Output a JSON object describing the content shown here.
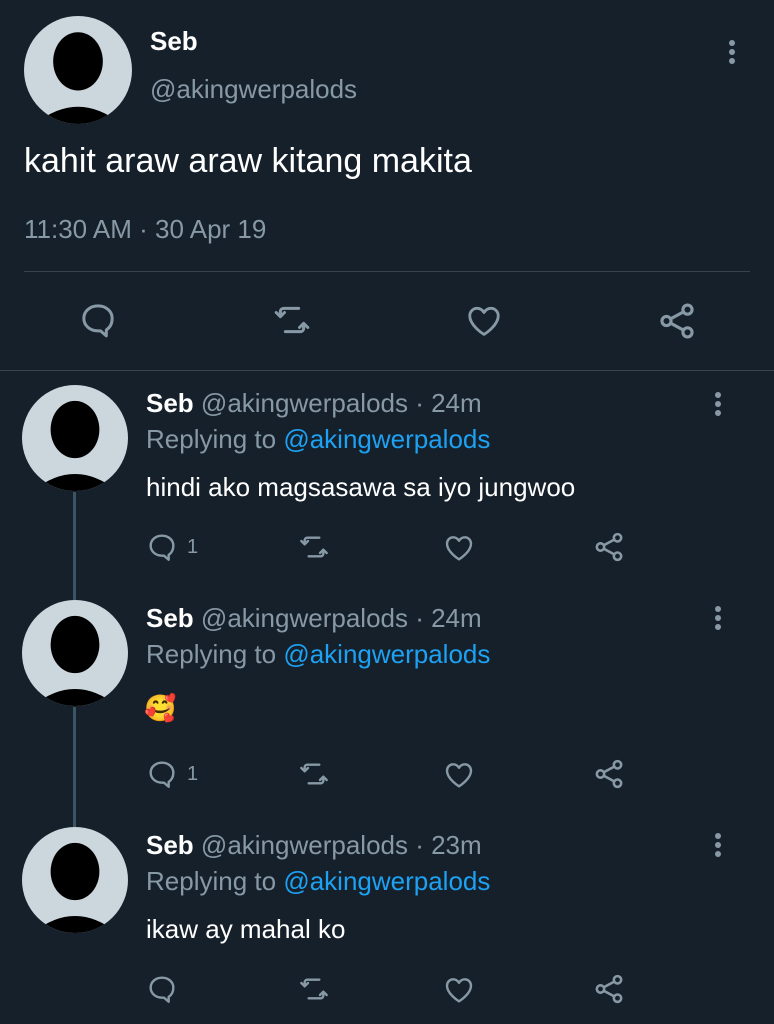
{
  "main_tweet": {
    "name": "Seb",
    "handle": "@akingwerpalods",
    "text": "kahit araw araw kitang makita",
    "timestamp": "11:30 AM · 30 Apr 19"
  },
  "replies": [
    {
      "name": "Seb",
      "handle_time": "@akingwerpalods · 24m",
      "replying_prefix": "Replying to",
      "replying_handle": "@akingwerpalods",
      "text": "hindi ako magsasawa sa iyo jungwoo",
      "reply_count": "1"
    },
    {
      "name": "Seb",
      "handle_time": "@akingwerpalods · 24m",
      "replying_prefix": "Replying to",
      "replying_handle": "@akingwerpalods",
      "text": "🥰",
      "reply_count": "1"
    },
    {
      "name": "Seb",
      "handle_time": "@akingwerpalods · 23m",
      "replying_prefix": "Replying to",
      "replying_handle": "@akingwerpalods",
      "text": "ikaw ay mahal ko",
      "reply_count": ""
    }
  ],
  "icons": {
    "reply": "reply-icon",
    "retweet": "retweet-icon",
    "like": "heart-icon",
    "share": "share-icon",
    "more": "more-vertical-icon"
  },
  "colors": {
    "background": "#15202b",
    "link": "#1da1f2",
    "muted": "#8899a6",
    "divider": "#38444d"
  }
}
